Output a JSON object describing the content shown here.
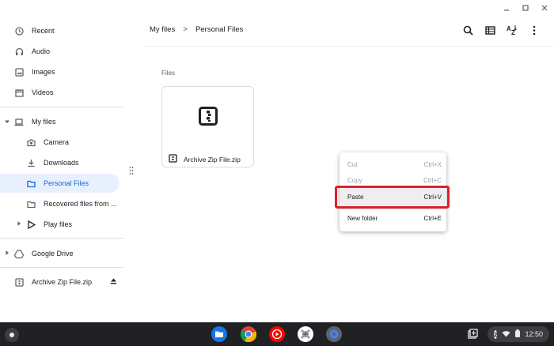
{
  "window_controls": [
    "minimize-icon",
    "maximize-icon",
    "close-icon"
  ],
  "sidebar": {
    "items": [
      {
        "label": "Recent",
        "icon": "clock-icon"
      },
      {
        "label": "Audio",
        "icon": "headphones-icon"
      },
      {
        "label": "Images",
        "icon": "image-icon"
      },
      {
        "label": "Videos",
        "icon": "film-icon"
      },
      {
        "label": "My files",
        "icon": "laptop-icon"
      },
      {
        "label": "Camera",
        "icon": "camera-icon"
      },
      {
        "label": "Downloads",
        "icon": "download-icon"
      },
      {
        "label": "Personal Files",
        "icon": "folder-icon",
        "active": true
      },
      {
        "label": "Recovered files from ...",
        "icon": "folder-icon"
      },
      {
        "label": "Play files",
        "icon": "play-store-icon"
      },
      {
        "label": "Google Drive",
        "icon": "drive-icon"
      },
      {
        "label": "Archive Zip File.zip",
        "icon": "archive-icon"
      }
    ]
  },
  "breadcrumb": {
    "root": "My files",
    "separator": ">",
    "current": "Personal Files"
  },
  "toolbar": [
    "search-icon",
    "list-view-icon",
    "sort-az-icon",
    "more-vert-icon"
  ],
  "content": {
    "section_label": "Files",
    "files": [
      {
        "name": "Archive Zip File.zip",
        "icon": "zip-icon"
      }
    ]
  },
  "context_menu": {
    "items": [
      {
        "label": "Cut",
        "shortcut": "Ctrl+X",
        "enabled": false
      },
      {
        "label": "Copy",
        "shortcut": "Ctrl+C",
        "enabled": false
      },
      {
        "label": "Paste",
        "shortcut": "Ctrl+V",
        "enabled": true,
        "highlighted": true
      },
      {
        "label": "New folder",
        "shortcut": "Ctrl+E",
        "enabled": true
      }
    ]
  },
  "shelf": {
    "apps": [
      "files-app-icon",
      "chrome-icon",
      "youtube-music-icon",
      "app-icon",
      "settings-icon"
    ],
    "tray": {
      "notification_count": "2",
      "time": "12:50"
    }
  },
  "colors": {
    "accent": "#1967d2",
    "active_bg": "#e8f0fe",
    "highlight_box": "#e01e2e",
    "shelf": "#202124"
  }
}
